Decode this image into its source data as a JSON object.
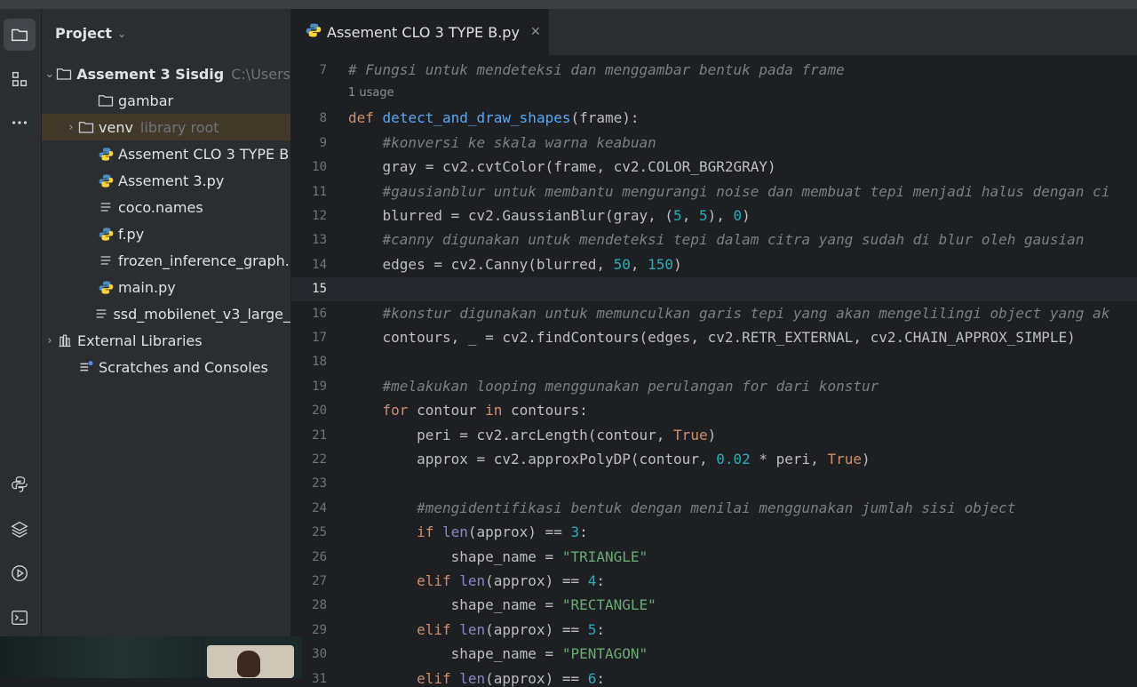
{
  "project_panel": {
    "title": "Project",
    "tree": [
      {
        "label": "Assement 3 Sisdig",
        "hint": "C:\\Users",
        "icon": "folder-icon",
        "expanded": true,
        "bold": true
      },
      {
        "label": "gambar",
        "hint": "",
        "icon": "folder-icon"
      },
      {
        "label": "venv",
        "hint": "library root",
        "icon": "folder-icon",
        "selected": true
      },
      {
        "label": "Assement CLO 3 TYPE B",
        "hint": "",
        "icon": "python-file-icon"
      },
      {
        "label": "Assement 3.py",
        "hint": "",
        "icon": "python-file-icon"
      },
      {
        "label": "coco.names",
        "hint": "",
        "icon": "text-file-icon"
      },
      {
        "label": "f.py",
        "hint": "",
        "icon": "python-file-icon"
      },
      {
        "label": "frozen_inference_graph.",
        "hint": "",
        "icon": "text-file-icon"
      },
      {
        "label": "main.py",
        "hint": "",
        "icon": "python-file-icon"
      },
      {
        "label": "ssd_mobilenet_v3_large_",
        "hint": "",
        "icon": "text-file-icon"
      },
      {
        "label": "External Libraries",
        "hint": "",
        "icon": "library-icon"
      },
      {
        "label": "Scratches and Consoles",
        "hint": "",
        "icon": "scratches-icon"
      }
    ]
  },
  "editor": {
    "tab_label": "Assement CLO 3 TYPE B.py",
    "usage_hint": "1 usage",
    "current_line": 15,
    "lines": [
      {
        "n": "7",
        "text": "# Fungsi untuk mendeteksi dan menggambar bentuk pada frame"
      },
      {
        "n": "8",
        "text": "def detect_and_draw_shapes(frame):"
      },
      {
        "n": "9",
        "text": "    #konversi ke skala warna keabuan"
      },
      {
        "n": "10",
        "text": "    gray = cv2.cvtColor(frame, cv2.COLOR_BGR2GRAY)"
      },
      {
        "n": "11",
        "text": "    #gausianblur untuk membantu mengurangi noise dan membuat tepi menjadi halus dengan ci"
      },
      {
        "n": "12",
        "text": "    blurred = cv2.GaussianBlur(gray, (5, 5), 0)"
      },
      {
        "n": "13",
        "text": "    #canny digunakan untuk mendeteksi tepi dalam citra yang sudah di blur oleh gausian"
      },
      {
        "n": "14",
        "text": "    edges = cv2.Canny(blurred, 50, 150)"
      },
      {
        "n": "15",
        "text": ""
      },
      {
        "n": "16",
        "text": "    #konstur digunakan untuk memunculkan garis tepi yang akan mengelilingi object yang ak"
      },
      {
        "n": "17",
        "text": "    contours, _ = cv2.findContours(edges, cv2.RETR_EXTERNAL, cv2.CHAIN_APPROX_SIMPLE)"
      },
      {
        "n": "18",
        "text": ""
      },
      {
        "n": "19",
        "text": "    #melakukan looping menggunakan perulangan for dari konstur"
      },
      {
        "n": "20",
        "text": "    for contour in contours:"
      },
      {
        "n": "21",
        "text": "        peri = cv2.arcLength(contour, True)"
      },
      {
        "n": "22",
        "text": "        approx = cv2.approxPolyDP(contour, 0.02 * peri, True)"
      },
      {
        "n": "23",
        "text": ""
      },
      {
        "n": "24",
        "text": "        #mengidentifikasi bentuk dengan menilai menggunakan jumlah sisi object"
      },
      {
        "n": "25",
        "text": "        if len(approx) == 3:"
      },
      {
        "n": "26",
        "text": "            shape_name = \"TRIANGLE\""
      },
      {
        "n": "27",
        "text": "        elif len(approx) == 4:"
      },
      {
        "n": "28",
        "text": "            shape_name = \"RECTANGLE\""
      },
      {
        "n": "29",
        "text": "        elif len(approx) == 5:"
      },
      {
        "n": "30",
        "text": "            shape_name = \"PENTAGON\""
      },
      {
        "n": "31",
        "text": "        elif len(approx) == 6:"
      }
    ]
  },
  "colors": {
    "comment": "#7a7e85",
    "keyword": "#cf8e6d",
    "function": "#56a8f5",
    "string": "#6aab73",
    "number": "#2aacb8",
    "builtin": "#8888c6",
    "default": "#bcbec4"
  },
  "sidebar_icons": [
    "project-folder-icon",
    "structure-icon",
    "more-icon",
    "python-console-icon",
    "layers-icon",
    "run-services-icon",
    "terminal-icon"
  ]
}
